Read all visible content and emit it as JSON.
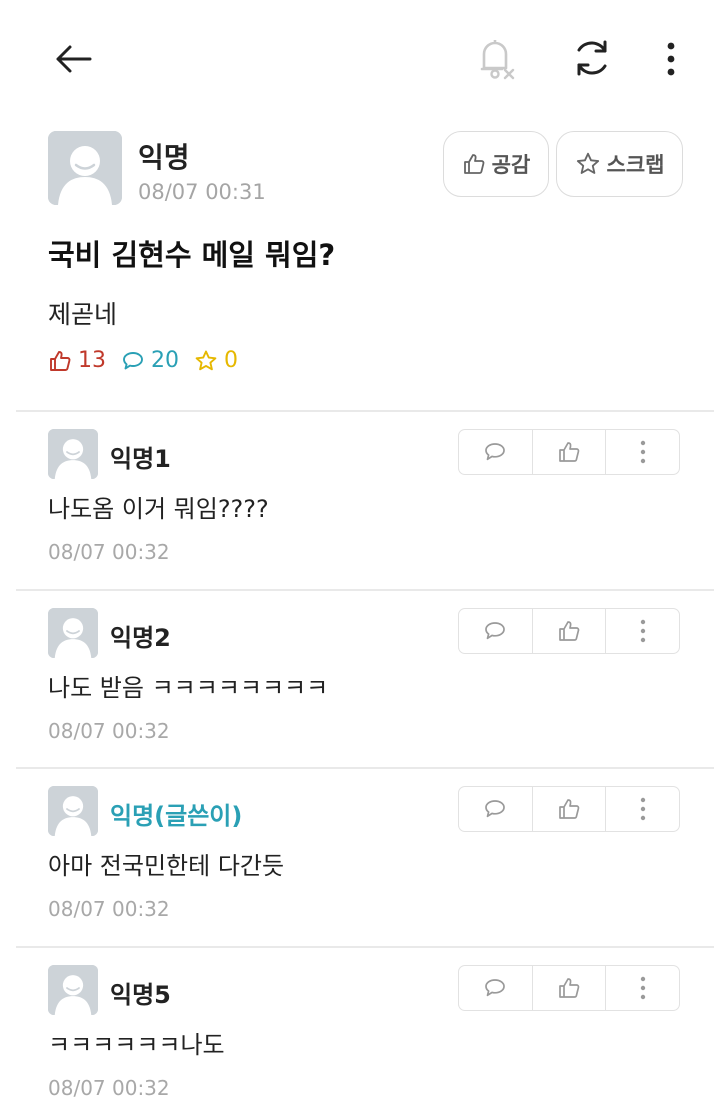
{
  "topbar": {
    "back_icon": "arrow-left-icon",
    "notify_icon": "bell-off-icon",
    "refresh_icon": "refresh-icon",
    "more_icon": "more-vertical-icon"
  },
  "post": {
    "author": "익명",
    "timestamp": "08/07 00:31",
    "like_button_label": "공감",
    "scrap_button_label": "스크랩",
    "title": "국비 김현수 메일 뭐임?",
    "body": "제곧네",
    "stats": {
      "likes": "13",
      "comments": "20",
      "scraps": "0"
    }
  },
  "colors": {
    "like": "#c0392b",
    "comment": "#2aa0b5",
    "scrap": "#e6b800",
    "op_name": "#2aa0b5"
  },
  "comments": [
    {
      "author": "익명1",
      "text": "나도옴 이거 뭐임????",
      "timestamp": "08/07 00:32",
      "is_op": false
    },
    {
      "author": "익명2",
      "text": "나도 받음 ㅋㅋㅋㅋㅋㅋㅋㅋ",
      "timestamp": "08/07 00:32",
      "is_op": false
    },
    {
      "author": "익명(글쓴이)",
      "text": "아마 전국민한테 다간듯",
      "timestamp": "08/07 00:32",
      "is_op": true
    },
    {
      "author": "익명5",
      "text": "ㅋㅋㅋㅋㅋㅋ나도",
      "timestamp": "08/07 00:32",
      "is_op": false
    }
  ]
}
